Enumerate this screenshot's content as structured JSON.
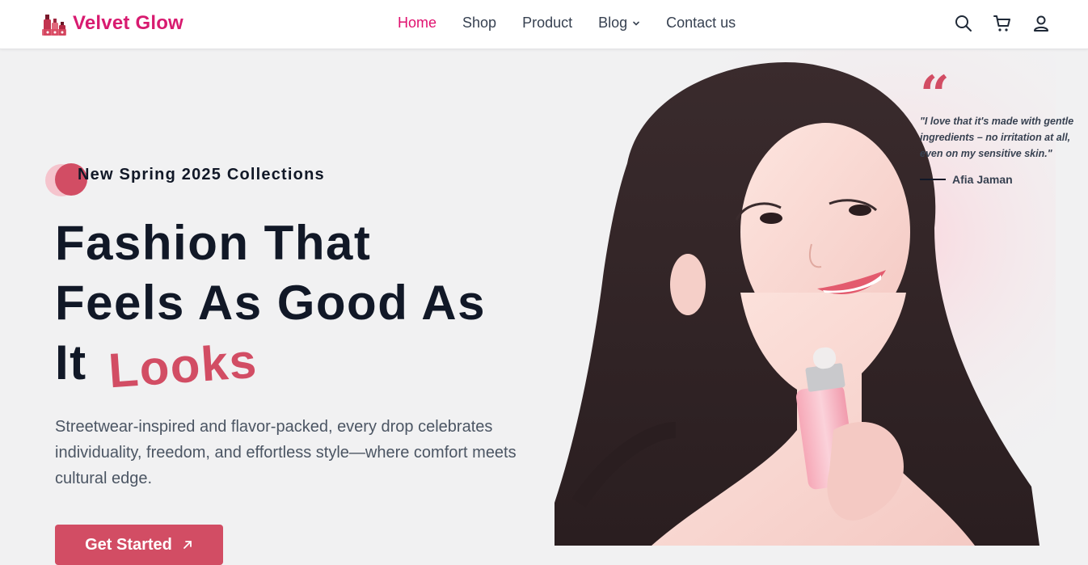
{
  "brand": {
    "name": "Velvet Glow",
    "color": "#d81b70"
  },
  "nav": {
    "items": [
      {
        "label": "Home",
        "active": true
      },
      {
        "label": "Shop",
        "active": false
      },
      {
        "label": "Product",
        "active": false
      },
      {
        "label": "Blog",
        "active": false,
        "has_dropdown": true
      },
      {
        "label": "Contact us",
        "active": false
      }
    ],
    "icons": [
      "search-icon",
      "cart-icon",
      "user-icon"
    ]
  },
  "hero": {
    "tagline": "New Spring 2025 Collections",
    "headline_line1": "Fashion That",
    "headline_line2": "Feels As Good As",
    "headline_line3_start": "It",
    "headline_accent": "Looks",
    "description": "Streetwear-inspired and flavor-packed, every drop celebrates individuality, freedom, and effortless style—where comfort meets cultural edge.",
    "cta_label": "Get Started",
    "accent_color": "#d24d64"
  },
  "testimonial": {
    "quote": "\"I love that it's made with gentle ingredients – no irritation at all, even on my sensitive skin.\"",
    "author": "Afia Jaman"
  }
}
